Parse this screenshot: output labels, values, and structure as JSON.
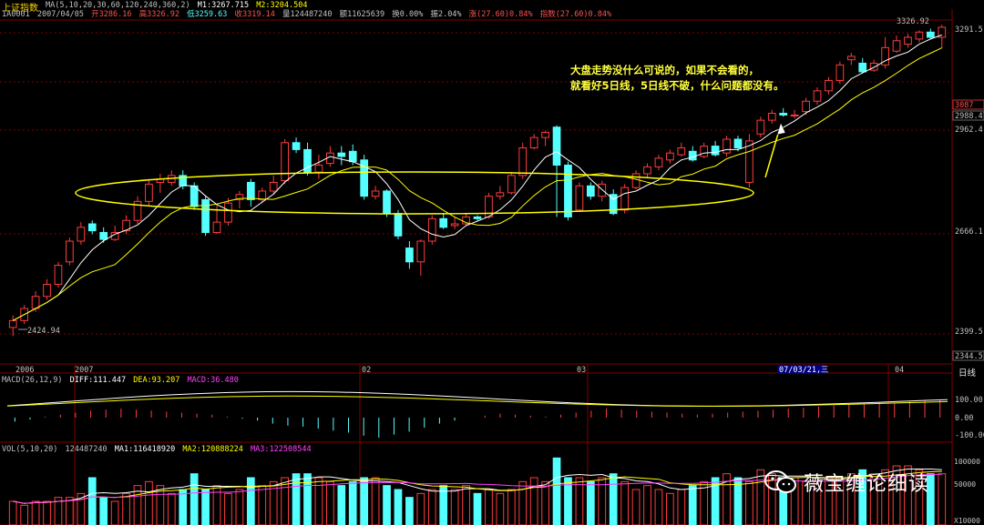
{
  "header": {
    "index_name": "上证指数",
    "ma_label": "MA(5,10,20,30,60,120,240,360,2)",
    "m1": "M1:3267.715",
    "m2": "M2:3204.504",
    "code": "1A0001",
    "date": "2007/04/05",
    "open": "开3286.16",
    "high": "高3326.92",
    "low": "低3259.63",
    "close": "收3319.14",
    "volume": "量124487240",
    "amount": "额11625639",
    "turnover": "换0.00%",
    "amplitude": "振2.04%",
    "change": "涨(27.60)0.84%",
    "index_change": "指数(27.60)0.84%"
  },
  "macd_header": {
    "label": "MACD(26,12,9)",
    "diff": "DIFF:111.447",
    "dea": "DEA:93.207",
    "macd": "MACD:36.480"
  },
  "vol_header": {
    "label": "VOL(5,10,20)",
    "vol": "124487240",
    "ma1": "MA1:116418920",
    "ma2": "MA2:120888224",
    "ma3": "MA3:122508544"
  },
  "annotation": {
    "line1": "大盘走势没什么可说的，如果不会看的，",
    "line2": "就看好5日线，5日线不破，什么问题都没有。"
  },
  "period_label": "日线",
  "watermark": "薇宝缠论细读",
  "colors": {
    "up": "#ff3c3c",
    "down": "#54ffff",
    "ma5": "#ffffff",
    "ma10": "#ffff00",
    "ellipse": "#ffff00",
    "grid": "#800000"
  },
  "chart_data": {
    "type": "candlestick",
    "price_labels": [
      "3291.5",
      "3087",
      "2988.47",
      "2962.4",
      "2666.1",
      "2399.5",
      "2344.5"
    ],
    "x_labels": [
      "2006",
      "2007",
      "02",
      "03",
      "07/03/21,三",
      "04"
    ],
    "high_mark": "3326.92",
    "low_mark": "2424.94",
    "macd_labels": [
      "100.00",
      "0.00",
      "-100.00"
    ],
    "vol_labels": [
      "100000",
      "50000",
      "X10000"
    ],
    "ylim": [
      2344.5,
      3340
    ],
    "candles": [
      [
        2450,
        2470,
        2425,
        2485
      ],
      [
        2470,
        2505,
        2460,
        2515
      ],
      [
        2505,
        2540,
        2495,
        2555
      ],
      [
        2540,
        2575,
        2530,
        2590
      ],
      [
        2575,
        2630,
        2565,
        2640
      ],
      [
        2640,
        2700,
        2630,
        2710
      ],
      [
        2700,
        2740,
        2690,
        2755
      ],
      [
        2750,
        2730,
        2720,
        2760
      ],
      [
        2725,
        2705,
        2695,
        2740
      ],
      [
        2705,
        2725,
        2700,
        2745
      ],
      [
        2730,
        2760,
        2720,
        2775
      ],
      [
        2760,
        2815,
        2750,
        2830
      ],
      [
        2815,
        2865,
        2805,
        2880
      ],
      [
        2870,
        2880,
        2840,
        2895
      ],
      [
        2870,
        2890,
        2860,
        2905
      ],
      [
        2890,
        2860,
        2850,
        2905
      ],
      [
        2860,
        2800,
        2790,
        2870
      ],
      [
        2820,
        2725,
        2715,
        2830
      ],
      [
        2725,
        2755,
        2720,
        2805
      ],
      [
        2755,
        2810,
        2745,
        2825
      ],
      [
        2820,
        2835,
        2795,
        2845
      ],
      [
        2870,
        2820,
        2800,
        2880
      ],
      [
        2820,
        2845,
        2810,
        2855
      ],
      [
        2845,
        2870,
        2835,
        2890
      ],
      [
        2875,
        2985,
        2865,
        2995
      ],
      [
        2985,
        2965,
        2955,
        3000
      ],
      [
        2965,
        2900,
        2890,
        2985
      ],
      [
        2900,
        2920,
        2880,
        2950
      ],
      [
        2925,
        2955,
        2915,
        2975
      ],
      [
        2955,
        2945,
        2920,
        2975
      ],
      [
        2960,
        2930,
        2920,
        2980
      ],
      [
        2935,
        2830,
        2820,
        2950
      ],
      [
        2830,
        2845,
        2820,
        2860
      ],
      [
        2845,
        2780,
        2770,
        2850
      ],
      [
        2780,
        2715,
        2705,
        2790
      ],
      [
        2680,
        2640,
        2620,
        2700
      ],
      [
        2640,
        2700,
        2600,
        2705
      ],
      [
        2700,
        2765,
        2690,
        2775
      ],
      [
        2765,
        2740,
        2735,
        2780
      ],
      [
        2745,
        2750,
        2735,
        2770
      ],
      [
        2750,
        2770,
        2745,
        2780
      ],
      [
        2770,
        2765,
        2760,
        2775
      ],
      [
        2770,
        2830,
        2765,
        2840
      ],
      [
        2830,
        2840,
        2820,
        2860
      ],
      [
        2840,
        2890,
        2835,
        2900
      ],
      [
        2890,
        2970,
        2880,
        2985
      ],
      [
        2970,
        3000,
        2965,
        3010
      ],
      [
        3000,
        3015,
        2975,
        3020
      ],
      [
        3030,
        2920,
        2770,
        3035
      ],
      [
        2920,
        2770,
        2760,
        2930
      ],
      [
        2790,
        2860,
        2785,
        2870
      ],
      [
        2860,
        2830,
        2820,
        2870
      ],
      [
        2830,
        2865,
        2815,
        2875
      ],
      [
        2835,
        2780,
        2775,
        2850
      ],
      [
        2790,
        2855,
        2780,
        2865
      ],
      [
        2855,
        2895,
        2850,
        2905
      ],
      [
        2895,
        2915,
        2885,
        2925
      ],
      [
        2915,
        2940,
        2905,
        2950
      ],
      [
        2935,
        2955,
        2925,
        2965
      ],
      [
        2950,
        2970,
        2945,
        2985
      ],
      [
        2960,
        2935,
        2930,
        2975
      ],
      [
        2945,
        2975,
        2940,
        2985
      ],
      [
        2975,
        2950,
        2945,
        2990
      ],
      [
        2955,
        2995,
        2945,
        3005
      ],
      [
        2995,
        2970,
        2960,
        3005
      ],
      [
        2870,
        2990,
        2855,
        3010
      ],
      [
        3010,
        3050,
        3000,
        3060
      ],
      [
        3050,
        3070,
        3040,
        3080
      ],
      [
        3070,
        3065,
        3060,
        3085
      ],
      [
        3065,
        3065,
        3055,
        3080
      ],
      [
        3075,
        3105,
        3065,
        3115
      ],
      [
        3105,
        3135,
        3095,
        3145
      ],
      [
        3135,
        3165,
        3125,
        3175
      ],
      [
        3165,
        3210,
        3155,
        3220
      ],
      [
        3225,
        3235,
        3210,
        3245
      ],
      [
        3215,
        3190,
        3185,
        3230
      ],
      [
        3195,
        3215,
        3190,
        3225
      ],
      [
        3210,
        3260,
        3200,
        3290
      ],
      [
        3250,
        3280,
        3245,
        3295
      ],
      [
        3270,
        3290,
        3260,
        3300
      ],
      [
        3285,
        3305,
        3275,
        3310
      ],
      [
        3305,
        3290,
        3285,
        3315
      ],
      [
        3290,
        3319,
        3259,
        3326
      ]
    ],
    "macd_hist": [
      -8,
      -4,
      2,
      6,
      10,
      14,
      16,
      18,
      16,
      14,
      12,
      10,
      8,
      6,
      2,
      -2,
      -6,
      -12,
      -16,
      -18,
      -22,
      -26,
      -30,
      -36,
      -40,
      -34,
      -28,
      -20,
      -12,
      -6,
      0,
      4,
      8,
      6,
      4,
      2,
      6,
      10,
      14,
      18,
      16,
      14,
      12,
      10,
      8,
      6,
      8,
      10,
      12,
      14,
      16,
      18,
      20,
      22,
      24,
      26,
      28,
      30,
      30,
      32,
      34,
      36
    ],
    "volume": [
      6,
      5,
      6,
      6,
      7,
      7,
      8,
      12,
      7,
      6,
      8,
      10,
      11,
      10,
      8,
      9,
      13,
      9,
      10,
      8,
      9,
      12,
      10,
      11,
      12,
      13,
      13,
      12,
      11,
      10,
      11,
      12,
      12,
      10,
      9,
      7,
      8,
      9,
      10,
      9,
      10,
      8,
      9,
      8,
      9,
      11,
      12,
      11,
      17,
      12,
      12,
      11,
      12,
      13,
      11,
      9,
      10,
      9,
      8,
      9,
      10,
      11,
      12,
      13,
      12,
      11,
      14,
      13,
      12,
      12,
      11,
      11,
      12,
      12,
      13,
      14,
      13,
      14,
      15,
      15,
      14,
      13,
      13
    ]
  }
}
